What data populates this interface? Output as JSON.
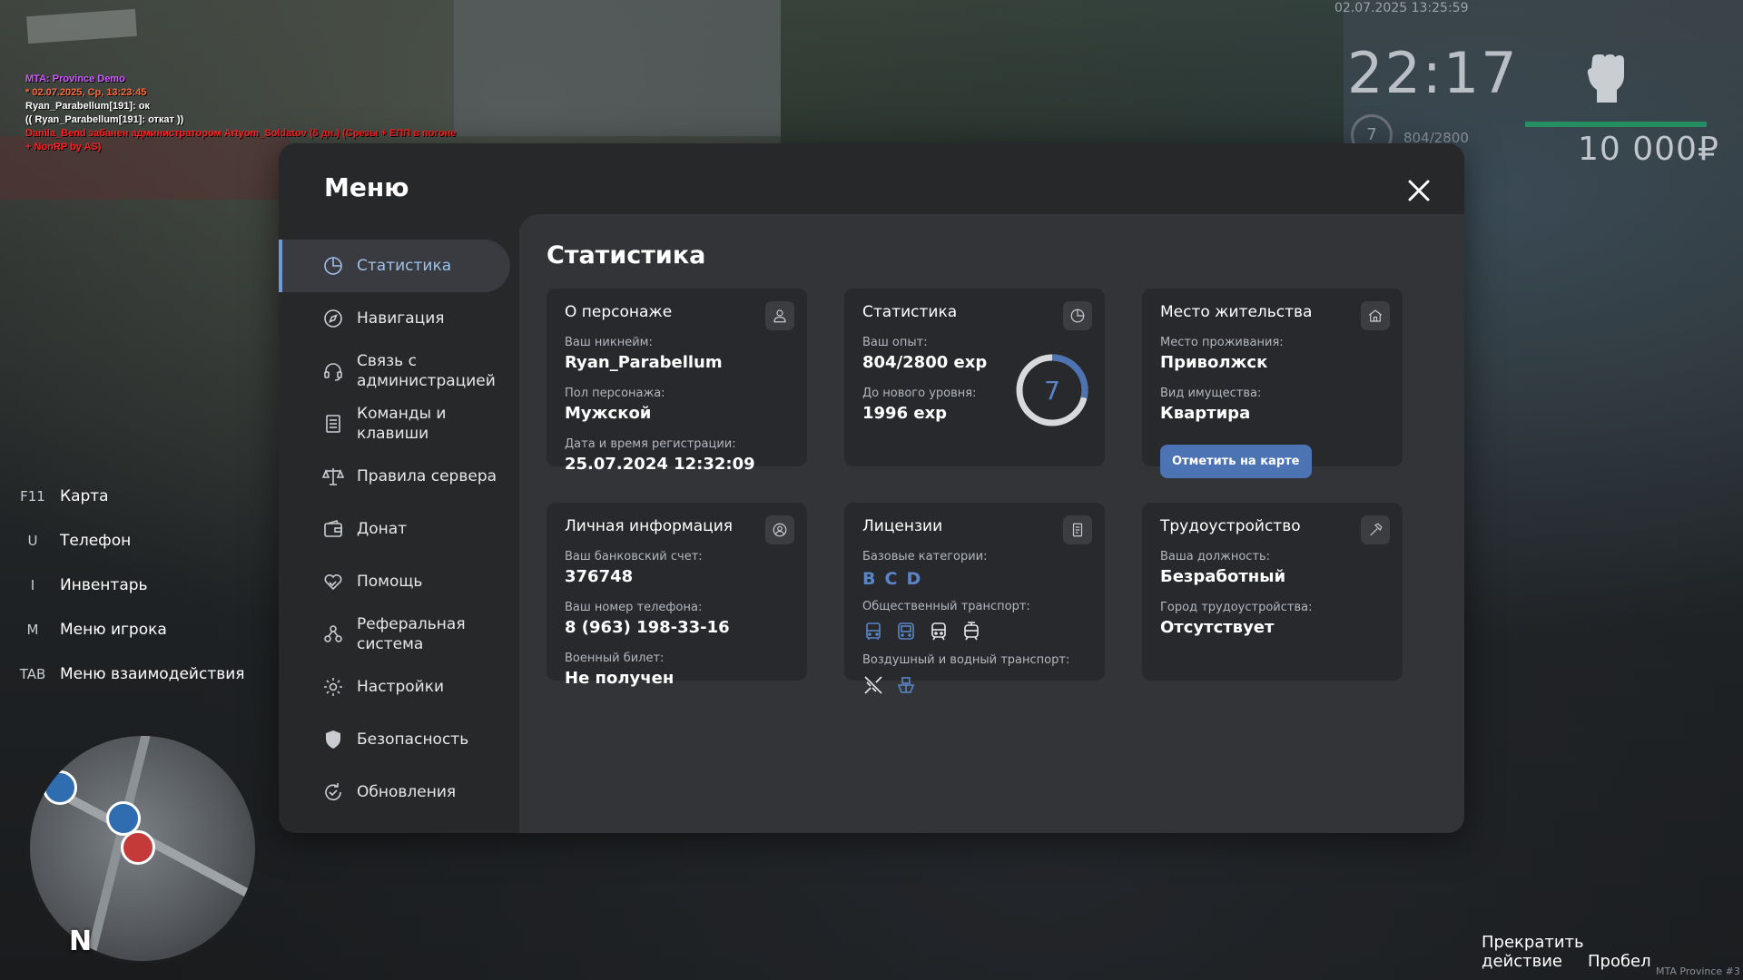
{
  "top_datetime": "02.07.2025 13:25:59",
  "chat": [
    "MTA: Province Demo",
    "* 02.07.2025, Ср, 13:23:45",
    "Ryan_Parabellum[191]: ок",
    "(( Ryan_Parabellum[191]: откат ))",
    "Danila_Bend забанен администратором Artyom_Soldatov (5 дн.) (Срезы + ЕПП в погоне + NonRP by AS)"
  ],
  "hud": {
    "time": "22:17",
    "level": "7",
    "exp": "804/2800",
    "money": "10 000₽"
  },
  "hotkeys": [
    {
      "key": "F11",
      "label": "Карта"
    },
    {
      "key": "U",
      "label": "Телефон"
    },
    {
      "key": "I",
      "label": "Инвентарь"
    },
    {
      "key": "M",
      "label": "Меню игрока"
    },
    {
      "key": "TAB",
      "label": "Меню взаимодействия"
    }
  ],
  "minimap": {
    "north": "N"
  },
  "menu": {
    "title": "Меню",
    "sidebar": [
      {
        "label": "Статистика",
        "icon": "chart-pie-icon",
        "active": true
      },
      {
        "label": "Навигация",
        "icon": "compass-icon"
      },
      {
        "label": "Связь с администрацией",
        "icon": "headset-icon"
      },
      {
        "label": "Команды и клавиши",
        "icon": "document-list-icon"
      },
      {
        "label": "Правила сервера",
        "icon": "scales-icon"
      },
      {
        "label": "Донат",
        "icon": "wallet-icon"
      },
      {
        "label": "Помощь",
        "icon": "handshake-heart-icon"
      },
      {
        "label": "Реферальная система",
        "icon": "referral-users-icon"
      },
      {
        "label": "Настройки",
        "icon": "gear-icon"
      },
      {
        "label": "Безопасность",
        "icon": "shield-icon"
      },
      {
        "label": "Обновления",
        "icon": "refresh-check-icon"
      }
    ],
    "content_title": "Статистика",
    "cards": {
      "character": {
        "title": "О персонаже",
        "icon": "user-icon",
        "nick_label": "Ваш никнейм:",
        "nick": "Ryan_Parabellum",
        "gender_label": "Пол персонажа:",
        "gender": "Мужской",
        "reg_label": "Дата и время регистрации:",
        "reg": "25.07.2024 12:32:09"
      },
      "stats": {
        "title": "Статистика",
        "icon": "chart-pie-icon",
        "exp_label": "Ваш опыт:",
        "exp": "804/2800 exp",
        "next_label": "До нового уровня:",
        "next": "1996 exp",
        "level": "7",
        "progress": 0.287
      },
      "residence": {
        "title": "Место жительства",
        "icon": "house-icon",
        "place_label": "Место проживания:",
        "place": "Приволжск",
        "property_label": "Вид имущества:",
        "property": "Квартира",
        "button": "Отметить на карте"
      },
      "personal": {
        "title": "Личная информация",
        "icon": "user-circle-icon",
        "bank_label": "Ваш банковский счет:",
        "bank": "376748",
        "phone_label": "Ваш номер телефона:",
        "phone": "8 (963) 198-33-16",
        "military_label": "Военный билет:",
        "military": "Не получен"
      },
      "licenses": {
        "title": "Лицензии",
        "icon": "license-card-icon",
        "base_label": "Базовые категории:",
        "base": [
          "B",
          "C",
          "D"
        ],
        "public_label": "Общественный транспорт:",
        "public_icons": [
          "bus-icon",
          "bus-front-icon",
          "train-icon",
          "tram-icon"
        ],
        "air_label": "Воздушный и водный транспорт:",
        "air_icons": [
          "plane-icon",
          "boat-icon"
        ]
      },
      "employment": {
        "title": "Трудоустройство",
        "icon": "hammer-icon",
        "job_label": "Ваша должность:",
        "job": "Безработный",
        "city_label": "Город трудоустройства:",
        "city": "Отсутствует"
      }
    }
  },
  "bottom": {
    "cancel": "Прекратить действие",
    "key": "Пробел"
  },
  "version": "MTA Province #3",
  "colors": {
    "accent": "#5a86c8",
    "button": "#4c74b4",
    "panel": "#27282a",
    "content": "#323437",
    "card": "#27292c"
  }
}
